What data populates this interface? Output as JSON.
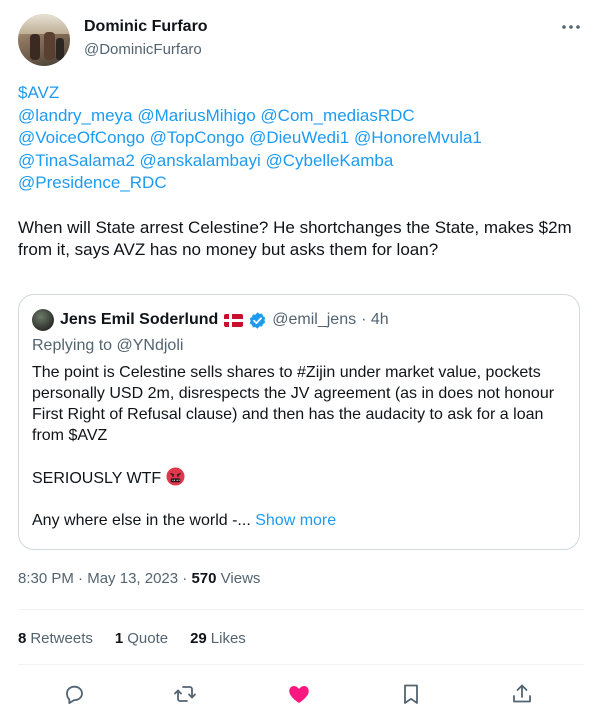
{
  "author": {
    "name": "Dominic Furfaro",
    "handle": "@DominicFurfaro",
    "avatar_icon": "user-avatar-photo",
    "more_icon": "more-dots-icon"
  },
  "tweet": {
    "mentions": [
      [
        "$AVZ"
      ],
      [
        "@landry_meya",
        "@MariusMihigo",
        "@Com_mediasRDC"
      ],
      [
        "@VoiceOfCongo",
        "@TopCongo",
        "@DieuWedi1",
        "@HonoreMvula1"
      ],
      [
        "@TinaSalama2",
        "@anskalambayi",
        "@CybelleKamba"
      ],
      [
        "@Presidence_RDC"
      ]
    ],
    "text": "When will State arrest Celestine? He shortchanges the State, makes $2m from it, says AVZ has no money but asks them for loan?"
  },
  "quote": {
    "name": "Jens Emil Soderlund",
    "flag": "denmark-flag",
    "verified_icon": "verified-badge-icon",
    "handle": "@emil_jens",
    "time": "· 4h",
    "replying_label": "Replying to",
    "replying_to": "@YNdjoli",
    "paragraph1": "The point is Celestine sells shares to #Zijin under market value, pockets personally USD 2m, disrespects the JV agreement (as in does not honour First Right of Refusal clause) and then has the audacity to ask for a loan from $AVZ",
    "paragraph2": "SERIOUSLY WTF",
    "paragraph2_emoji": "angry-face-with-symbols-emoji",
    "paragraph3": "Any where else in the world -...",
    "show_more": "Show more"
  },
  "meta": {
    "time": "8:30 PM",
    "sep1": "·",
    "date": "May 13, 2023",
    "sep2": "·",
    "views_count": "570",
    "views_label": "Views"
  },
  "stats": {
    "retweets_count": "8",
    "retweets_label": "Retweets",
    "quotes_count": "1",
    "quotes_label": "Quote",
    "likes_count": "29",
    "likes_label": "Likes"
  },
  "actions": [
    "reply-icon",
    "retweet-icon",
    "like-icon",
    "bookmark-icon",
    "share-icon"
  ],
  "colors": {
    "link": "#1d9bf0",
    "secondary_text": "#536471",
    "like": "#f91880",
    "border": "#cfd9de"
  }
}
